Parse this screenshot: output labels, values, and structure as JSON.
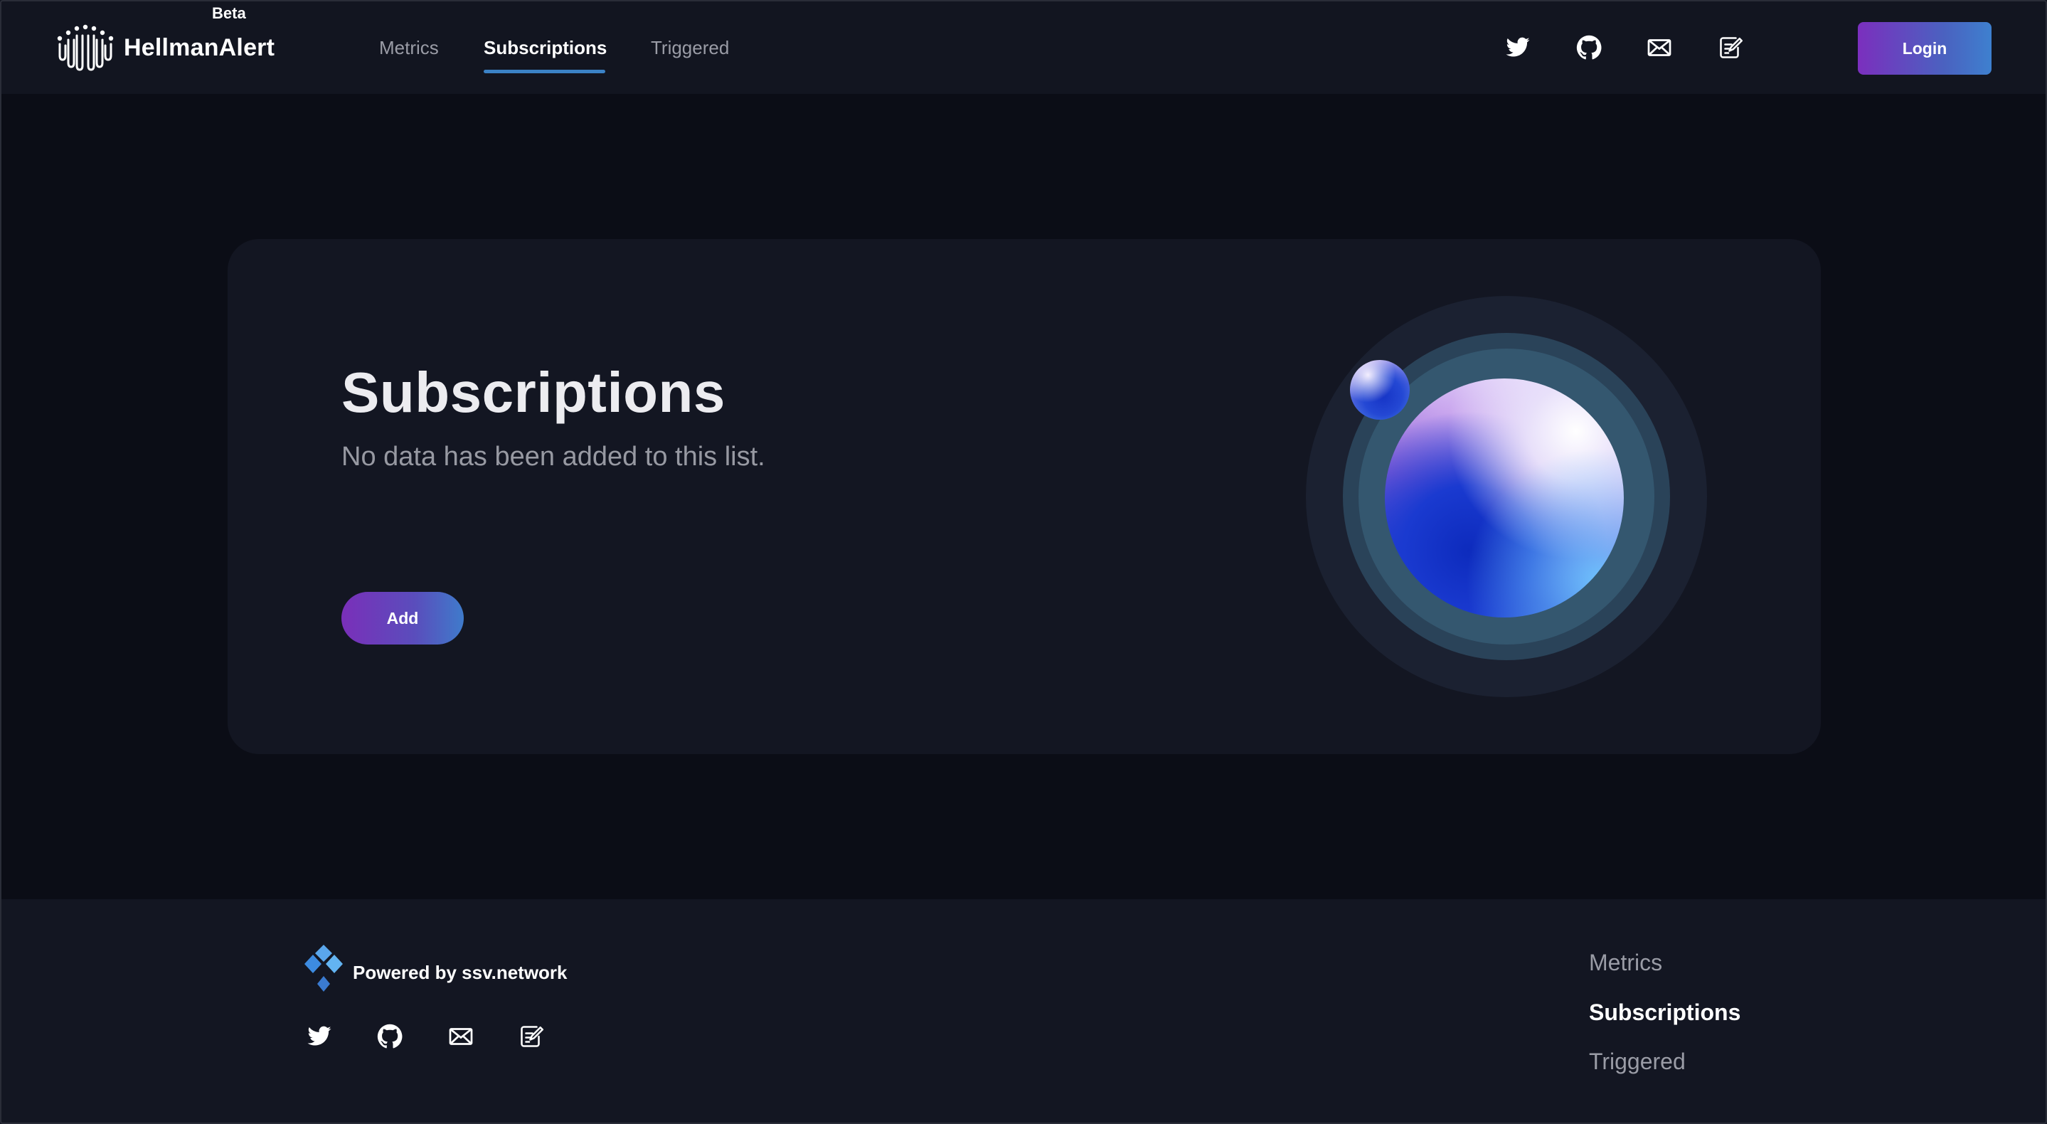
{
  "header": {
    "brand": "HellmanAlert",
    "badge": "Beta",
    "nav": [
      {
        "label": "Metrics",
        "active": false
      },
      {
        "label": "Subscriptions",
        "active": true
      },
      {
        "label": "Triggered",
        "active": false
      }
    ],
    "social_icons": [
      "twitter-icon",
      "github-icon",
      "mail-icon",
      "notes-edit-icon"
    ],
    "login_label": "Login"
  },
  "main": {
    "title": "Subscriptions",
    "subtitle": "No data has been added to this list.",
    "add_label": "Add"
  },
  "footer": {
    "powered_by": "Powered by ssv.network",
    "social_icons": [
      "twitter-icon",
      "github-icon",
      "mail-icon",
      "notes-edit-icon"
    ],
    "links": [
      {
        "label": "Metrics",
        "active": false
      },
      {
        "label": "Subscriptions",
        "active": true
      },
      {
        "label": "Triggered",
        "active": false
      }
    ]
  },
  "colors": {
    "background": "#0b0d16",
    "surface": "#131622",
    "accent_blue": "#3b82c6",
    "gradient_start": "#7b2fbe",
    "gradient_end": "#3e80cf"
  }
}
